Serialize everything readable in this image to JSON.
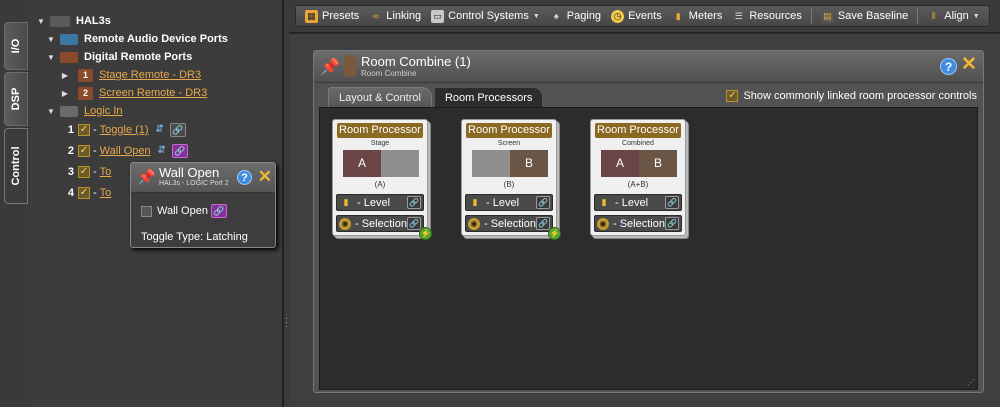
{
  "side_tabs": [
    "I/O",
    "DSP",
    "Control"
  ],
  "tree": {
    "root": "HAL3s",
    "groups": [
      {
        "label": "Remote Audio Device Ports",
        "color": "#3b78a6"
      },
      {
        "label": "Digital Remote Ports",
        "color": "#8a4a2c"
      },
      {
        "label": "Logic In",
        "color": "#6b6b6b"
      }
    ],
    "remotes": [
      {
        "num": "1",
        "label": "Stage Remote - DR3"
      },
      {
        "num": "2",
        "label": "Screen Remote - DR3"
      }
    ],
    "logic_items": [
      {
        "num": "1",
        "label": "Toggle (1)"
      },
      {
        "num": "2",
        "label": "Wall Open"
      },
      {
        "num": "3",
        "label": "To"
      },
      {
        "num": "4",
        "label": "To"
      }
    ]
  },
  "toolbar": {
    "presets": "Presets",
    "linking": "Linking",
    "control_systems": "Control Systems",
    "paging": "Paging",
    "events": "Events",
    "meters": "Meters",
    "resources": "Resources",
    "save_baseline": "Save Baseline",
    "align": "Align"
  },
  "window": {
    "title": "Room Combine (1)",
    "subtitle": "Room Combine",
    "tabs": [
      "Layout & Control",
      "Room Processors"
    ],
    "active_tab": "Room Processors",
    "show_linked_label": "Show commonly linked room processor controls",
    "show_linked_checked": true
  },
  "processors": [
    {
      "title": "Room Processor",
      "name": "Stage",
      "a": "A",
      "b": "",
      "state": "(A)",
      "level": "- Level",
      "selection": "- Selection"
    },
    {
      "title": "Room Processor",
      "name": "Screen",
      "a": "",
      "b": "B",
      "state": "(B)",
      "level": "- Level",
      "selection": "- Selection"
    },
    {
      "title": "Room Processor",
      "name": "Combined",
      "a": "A",
      "b": "B",
      "state": "(A+B)",
      "level": "- Level",
      "selection": "- Selection"
    }
  ],
  "popup": {
    "title": "Wall Open",
    "subtitle": "HAL3s - LOGIC Port 2",
    "checkbox_label": "Wall Open",
    "type_text": "Toggle Type: Latching"
  },
  "colors": {
    "accent_gold": "#8a6a22",
    "link_orange": "#e8a94c",
    "room_a": "#6b4545",
    "room_b": "#6b5545",
    "room_inactive": "#8f8f8f"
  }
}
